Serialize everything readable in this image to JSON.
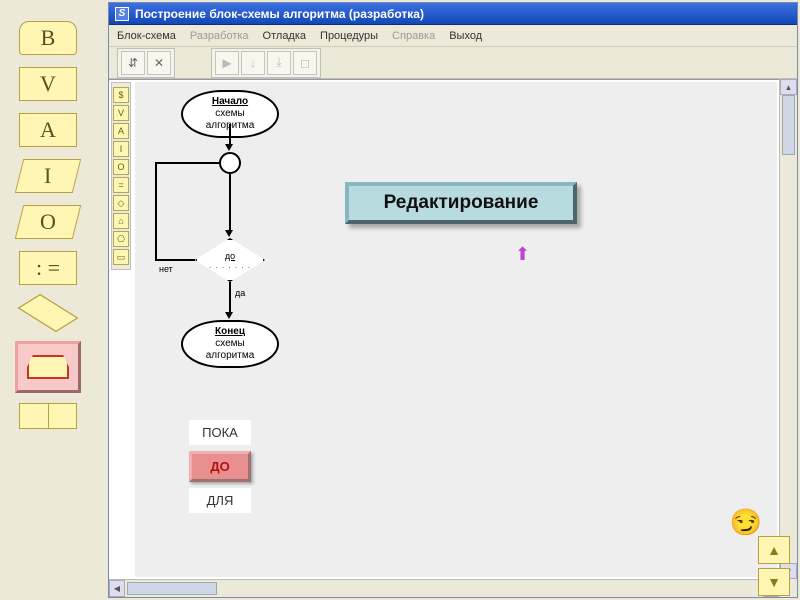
{
  "palette": {
    "b": "B",
    "v": "V",
    "a": "A",
    "i": "I",
    "o": "O",
    "assign": ": ="
  },
  "window": {
    "title": "Построение блок-схемы алгоритма (разработка)"
  },
  "menu": {
    "m1": "Блок-схема",
    "m2": "Разработка",
    "m3": "Отладка",
    "m4": "Процедуры",
    "m5": "Справка",
    "m6": "Выход"
  },
  "flow": {
    "start_title": "Начало",
    "start_sub": "схемы алгоритма",
    "cond_label": "до",
    "cond_dots": ". . . . . . .",
    "no": "нет",
    "yes": "да",
    "end_title": "Конец",
    "end_sub": "схемы алгоритма"
  },
  "big_button": "Редактирование",
  "loops": {
    "l1": "ПОКА",
    "l2": "ДО",
    "l3": "ДЛЯ"
  },
  "nav": {
    "emoji": "😏"
  },
  "toolbar": {
    "g1a": "⇵",
    "g1b": "✕",
    "g2a": "▶",
    "g2b": "↓",
    "g2c": "⤓",
    "g2d": "◻"
  },
  "vtool": [
    "$",
    "V",
    "A",
    "I",
    "O",
    "=",
    "◇",
    "⌂",
    "⎔",
    "▭"
  ]
}
